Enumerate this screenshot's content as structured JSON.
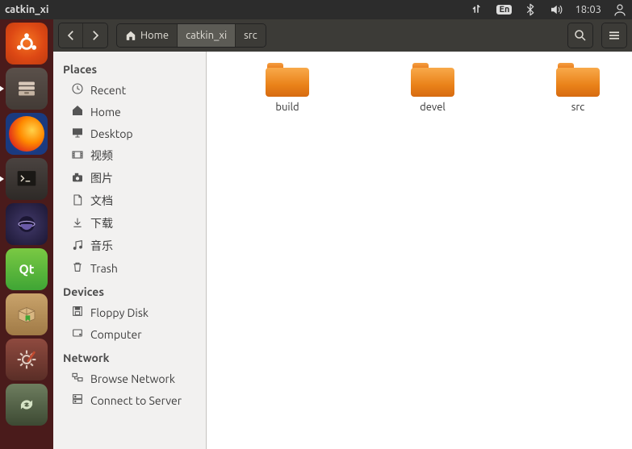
{
  "menubar": {
    "title": "catkin_xi",
    "lang_badge": "En",
    "time": "18:03"
  },
  "toolbar": {
    "crumbs": [
      {
        "label": "Home",
        "icon": "home",
        "active": false
      },
      {
        "label": "catkin_xi",
        "icon": null,
        "active": true
      },
      {
        "label": "src",
        "icon": null,
        "active": false
      }
    ]
  },
  "sidebar": {
    "sections": [
      {
        "title": "Places",
        "items": [
          {
            "icon": "clock",
            "label": "Recent"
          },
          {
            "icon": "home",
            "label": "Home"
          },
          {
            "icon": "desktop",
            "label": "Desktop"
          },
          {
            "icon": "video",
            "label": "视频"
          },
          {
            "icon": "camera",
            "label": "图片"
          },
          {
            "icon": "doc",
            "label": "文档"
          },
          {
            "icon": "down",
            "label": "下载"
          },
          {
            "icon": "music",
            "label": "音乐"
          },
          {
            "icon": "trash",
            "label": "Trash"
          }
        ]
      },
      {
        "title": "Devices",
        "items": [
          {
            "icon": "floppy",
            "label": "Floppy Disk"
          },
          {
            "icon": "disk",
            "label": "Computer"
          }
        ]
      },
      {
        "title": "Network",
        "items": [
          {
            "icon": "net",
            "label": "Browse Network"
          },
          {
            "icon": "server",
            "label": "Connect to Server"
          }
        ]
      }
    ]
  },
  "content": {
    "folders": [
      {
        "name": "build"
      },
      {
        "name": "devel"
      },
      {
        "name": "src"
      }
    ]
  },
  "launcher": {
    "items": [
      {
        "name": "ubuntu-dash",
        "class": "ic-ubuntu",
        "running": false
      },
      {
        "name": "files",
        "class": "ic-files",
        "running": true
      },
      {
        "name": "firefox",
        "class": "ic-firefox",
        "running": false
      },
      {
        "name": "terminal",
        "class": "ic-term",
        "running": true
      },
      {
        "name": "eclipse",
        "class": "ic-eclipse",
        "running": false
      },
      {
        "name": "qt-creator",
        "class": "ic-qt",
        "running": false
      },
      {
        "name": "software-pkg",
        "class": "ic-box",
        "running": false
      },
      {
        "name": "settings",
        "class": "ic-gear",
        "running": false
      },
      {
        "name": "updater",
        "class": "ic-update",
        "running": false
      }
    ]
  }
}
